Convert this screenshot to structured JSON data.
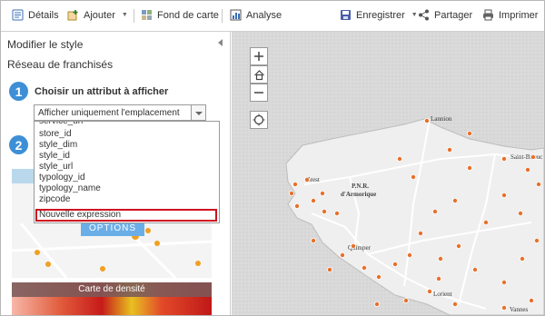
{
  "toolbar": {
    "details": "Détails",
    "add": "Ajouter",
    "basemap": "Fond de carte",
    "analysis": "Analyse",
    "save": "Enregistrer",
    "share": "Partager",
    "print": "Imprimer"
  },
  "panel": {
    "title": "Modifier le style",
    "layer_name": "Réseau de franchisés",
    "step1_number": "1",
    "step2_number": "2",
    "step1_label": "Choisir un attribut à afficher",
    "select_value": "Afficher uniquement l'emplacement",
    "dropdown": {
      "partial_item": "service_url",
      "items": [
        "store_id",
        "style_dim",
        "style_id",
        "style_url",
        "typology_id",
        "typology_name",
        "zipcode"
      ],
      "new_expression": "Nouvelle expression"
    },
    "options_button": "OPTIONS",
    "density_label": "Carte de densité"
  },
  "map": {
    "labels": {
      "lannion": "Lannion",
      "saint_brieuc": "Saint-Brieuc",
      "brest": "Brest",
      "pnr_line1": "P.N.R.",
      "pnr_line2": "d'Armorique",
      "quimper": "Quimper",
      "lorient": "Lorient",
      "vannes": "Vannes"
    },
    "colors": {
      "land": "#eeeeee",
      "sea": "#d9d9d9",
      "marker": "#e8702a",
      "road": "#ffffff"
    }
  }
}
